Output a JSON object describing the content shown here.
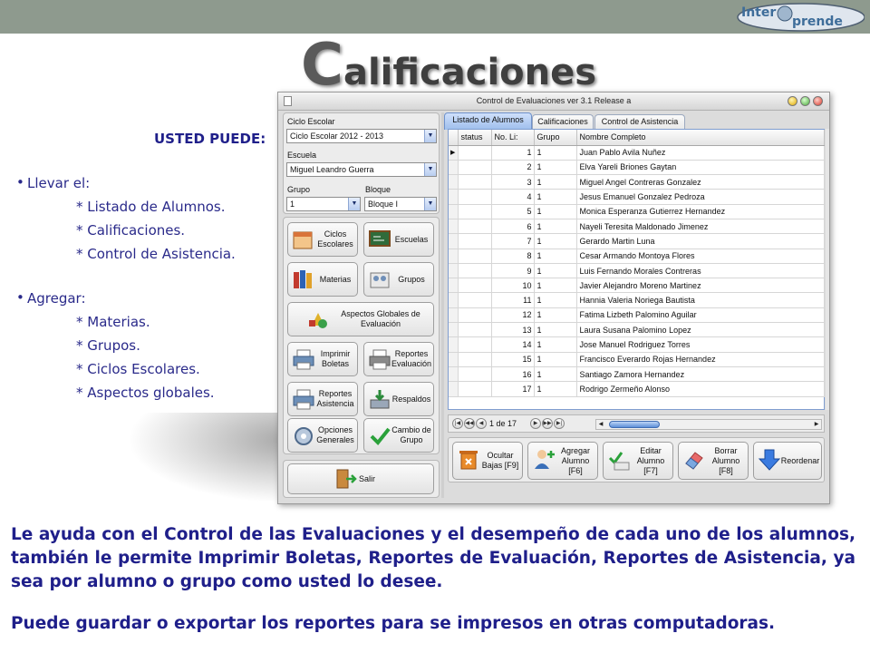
{
  "logo": {
    "text_part1": "Inter",
    "text_part2": "prende"
  },
  "slide_title": {
    "first_letter": "C",
    "rest": "alificaciones"
  },
  "left_panel": {
    "heading": "USTED PUEDE:",
    "bullets": [
      {
        "label": "Llevar el:",
        "items": [
          "* Listado de Alumnos.",
          "* Calificaciones.",
          "* Control de Asistencia."
        ]
      },
      {
        "label": "Agregar:",
        "items": [
          "* Materias.",
          "* Grupos.",
          "* Ciclos Escolares.",
          "* Aspectos globales."
        ]
      }
    ]
  },
  "window": {
    "title": "Control de Evaluaciones ver 3.1 Release a",
    "filters": {
      "ciclo_label": "Ciclo Escolar",
      "ciclo_value": "Ciclo Escolar 2012 - 2013",
      "escuela_label": "Escuela",
      "escuela_value": "Miguel Leandro Guerra",
      "grupo_label": "Grupo",
      "grupo_value": "1",
      "bloque_label": "Bloque",
      "bloque_value": "Bloque I"
    },
    "side_buttons": {
      "ciclos": "Ciclos Escolares",
      "escuelas": "Escuelas",
      "materias": "Materias",
      "grupos": "Grupos",
      "aspectos": "Aspectos Globales de Evaluación",
      "imprimir": "Imprimir Boletas",
      "reportes_eval": "Reportes Evaluación",
      "reportes_asis": "Reportes Asistencia",
      "respaldos": "Respaldos",
      "opciones": "Opciones Generales",
      "cambio": "Cambio de Grupo",
      "salir": "Salir"
    },
    "tabs": [
      "Listado de Alumnos",
      "Calificaciones",
      "Control de Asistencia"
    ],
    "grid": {
      "columns": [
        "status",
        "No. Li:",
        "Grupo",
        "Nombre Completo"
      ],
      "rows": [
        [
          "1",
          "1",
          "Juan Pablo Avila Nuñez"
        ],
        [
          "2",
          "1",
          "Elva Yareli Briones Gaytan"
        ],
        [
          "3",
          "1",
          "Miguel Angel Contreras Gonzalez"
        ],
        [
          "4",
          "1",
          "Jesus Emanuel Gonzalez Pedroza"
        ],
        [
          "5",
          "1",
          "Monica Esperanza Gutierrez Hernandez"
        ],
        [
          "6",
          "1",
          "Nayeli Teresita Maldonado Jimenez"
        ],
        [
          "7",
          "1",
          "Gerardo Martin Luna"
        ],
        [
          "8",
          "1",
          "Cesar Armando Montoya Flores"
        ],
        [
          "9",
          "1",
          "Luis Fernando Morales Contreras"
        ],
        [
          "10",
          "1",
          "Javier Alejandro Moreno Martinez"
        ],
        [
          "11",
          "1",
          "Hannia Valeria Noriega Bautista"
        ],
        [
          "12",
          "1",
          "Fatima Lizbeth Palomino Aguilar"
        ],
        [
          "13",
          "1",
          "Laura Susana Palomino Lopez"
        ],
        [
          "14",
          "1",
          "Jose Manuel Rodriguez Torres"
        ],
        [
          "15",
          "1",
          "Francisco Everardo Rojas Hernandez"
        ],
        [
          "16",
          "1",
          "Santiago Zamora Hernandez"
        ],
        [
          "17",
          "1",
          "Rodrigo Zermeño Alonso"
        ]
      ]
    },
    "pager": "1 de 17",
    "actions": {
      "ocultar": "Ocultar Bajas [F9]",
      "agregar": "Agregar Alumno [F6]",
      "editar": "Editar Alumno [F7]",
      "borrar": "Borrar Alumno [F8]",
      "reordenar": "Reordenar"
    }
  },
  "description": {
    "paragraph1": "Le ayuda con el Control de las Evaluaciones y el desempeño de cada uno de los alumnos, también le permite Imprimir Boletas, Reportes de Evaluación, Reportes de Asistencia, ya sea por alumno o grupo como usted lo desee.",
    "paragraph2": "Puede guardar o exportar los reportes para se impresos en otras computadoras."
  },
  "colors": {
    "text_blue": "#1f1f8a",
    "tab_active": "#9ebeec",
    "top_band": "#8e9a8e"
  }
}
